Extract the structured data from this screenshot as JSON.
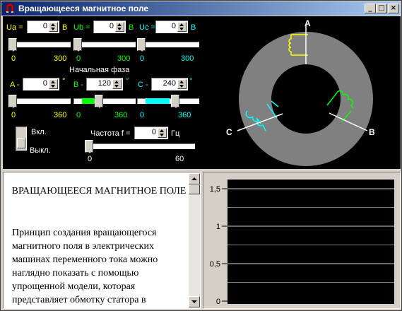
{
  "window": {
    "title": "Вращающееся магнитное поле",
    "min_glyph": "_",
    "max_glyph": "□",
    "close_glyph": "×"
  },
  "colors": {
    "yellow": "#ffff00",
    "green": "#00ff00",
    "cyan": "#00ffff",
    "gray_ring": "#808080"
  },
  "voltage": {
    "ua": {
      "label": "Ua =",
      "value": "0",
      "unit": "B",
      "min": "0",
      "max": "300"
    },
    "ub": {
      "label": "Ub =",
      "value": "0",
      "unit": "B",
      "min": "0",
      "max": "300"
    },
    "uc": {
      "label": "Uc =",
      "value": "0",
      "unit": "B",
      "min": "0",
      "max": "300"
    }
  },
  "phase": {
    "title": "Начальная фаза",
    "a": {
      "label": "A -",
      "value": "0",
      "unit": "°",
      "min": "0",
      "max": "360"
    },
    "b": {
      "label": "B -",
      "value": "120",
      "unit": "°",
      "min": "0",
      "max": "360"
    },
    "c": {
      "label": "C -",
      "value": "240",
      "unit": "°",
      "min": "0",
      "max": "360"
    }
  },
  "power": {
    "on_label": "Вкл.",
    "off_label": "Выкл."
  },
  "frequency": {
    "label": "Частота f =",
    "value": "0",
    "unit": "Гц",
    "min": "0",
    "max": "60"
  },
  "diagram": {
    "label_a": "A",
    "label_b": "B",
    "label_c": "C"
  },
  "text": {
    "heading": "ВРАЩАЮЩЕЕСЯ МАГНИТНОЕ ПОЛЕ",
    "body": "Принцип создания вращающегося магнитного поля в электрических машинах переменного тока можно наглядно показать с помощью упрощенной модели, которая представляет обмотку статора в"
  },
  "plot": {
    "tick_15": "1,5",
    "tick_1": "1",
    "tick_05": "0,5",
    "tick_0": "0"
  },
  "chart_data": {
    "type": "line",
    "ylim": [
      0,
      1.6
    ],
    "yticks": [
      "0",
      "0,5",
      "1",
      "1,5"
    ],
    "series": [],
    "grid": true
  }
}
